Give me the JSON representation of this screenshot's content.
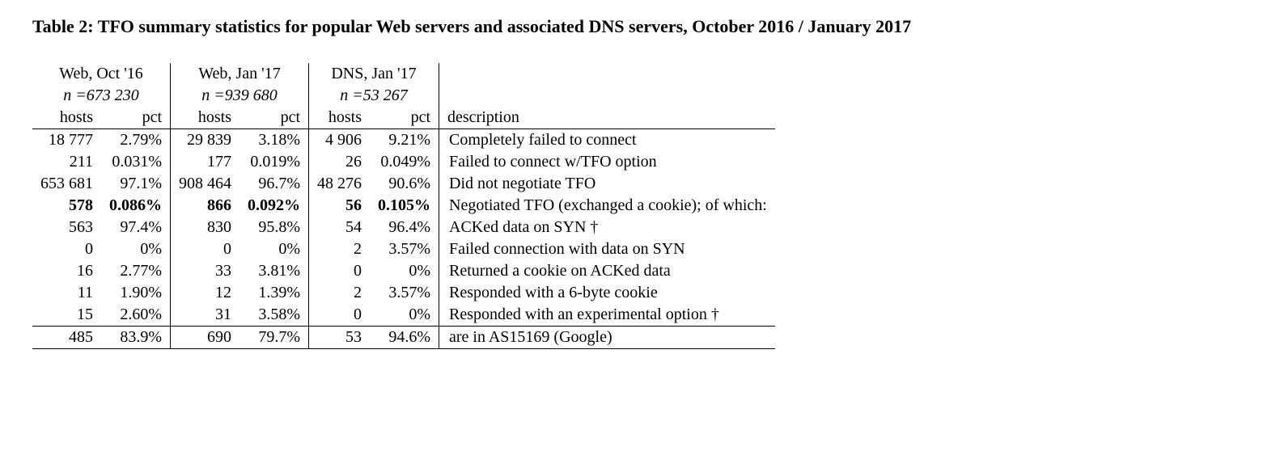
{
  "caption": "Table 2: TFO summary statistics for popular Web servers and associated DNS servers, October 2016 / January 2017",
  "groups": [
    {
      "label": "Web, Oct '16",
      "n": "n =673 230"
    },
    {
      "label": "Web, Jan '17",
      "n": "n =939 680"
    },
    {
      "label": "DNS, Jan '17",
      "n": "n =53 267"
    }
  ],
  "colLabels": {
    "hosts": "hosts",
    "pct": "pct",
    "desc": "description"
  },
  "rows": [
    {
      "bold": false,
      "desc": "Completely failed to connect",
      "cells": [
        {
          "hosts": "18 777",
          "pct": "2.79%"
        },
        {
          "hosts": "29 839",
          "pct": "3.18%"
        },
        {
          "hosts": "4 906",
          "pct": "9.21%"
        }
      ]
    },
    {
      "bold": false,
      "desc": "Failed to connect w/TFO option",
      "cells": [
        {
          "hosts": "211",
          "pct": "0.031%"
        },
        {
          "hosts": "177",
          "pct": "0.019%"
        },
        {
          "hosts": "26",
          "pct": "0.049%"
        }
      ]
    },
    {
      "bold": false,
      "desc": "Did not negotiate TFO",
      "cells": [
        {
          "hosts": "653 681",
          "pct": "97.1%"
        },
        {
          "hosts": "908 464",
          "pct": "96.7%"
        },
        {
          "hosts": "48 276",
          "pct": "90.6%"
        }
      ]
    },
    {
      "bold": true,
      "desc": "Negotiated TFO (exchanged a cookie); of which:",
      "cells": [
        {
          "hosts": "578",
          "pct": "0.086%"
        },
        {
          "hosts": "866",
          "pct": "0.092%"
        },
        {
          "hosts": "56",
          "pct": "0.105%"
        }
      ]
    },
    {
      "bold": false,
      "desc": "ACKed data on SYN †",
      "cells": [
        {
          "hosts": "563",
          "pct": "97.4%"
        },
        {
          "hosts": "830",
          "pct": "95.8%"
        },
        {
          "hosts": "54",
          "pct": "96.4%"
        }
      ]
    },
    {
      "bold": false,
      "desc": "Failed connection with data on SYN",
      "cells": [
        {
          "hosts": "0",
          "pct": "0%"
        },
        {
          "hosts": "0",
          "pct": "0%"
        },
        {
          "hosts": "2",
          "pct": "3.57%"
        }
      ]
    },
    {
      "bold": false,
      "desc": "Returned a cookie on ACKed data",
      "cells": [
        {
          "hosts": "16",
          "pct": "2.77%"
        },
        {
          "hosts": "33",
          "pct": "3.81%"
        },
        {
          "hosts": "0",
          "pct": "0%"
        }
      ]
    },
    {
      "bold": false,
      "desc": "Responded with a 6-byte cookie",
      "cells": [
        {
          "hosts": "11",
          "pct": "1.90%"
        },
        {
          "hosts": "12",
          "pct": "1.39%"
        },
        {
          "hosts": "2",
          "pct": "3.57%"
        }
      ]
    },
    {
      "bold": false,
      "desc": "Responded with an experimental option †",
      "cells": [
        {
          "hosts": "15",
          "pct": "2.60%"
        },
        {
          "hosts": "31",
          "pct": "3.58%"
        },
        {
          "hosts": "0",
          "pct": "0%"
        }
      ]
    },
    {
      "bold": false,
      "desc": "are in AS15169 (Google)",
      "cells": [
        {
          "hosts": "485",
          "pct": "83.9%"
        },
        {
          "hosts": "690",
          "pct": "79.7%"
        },
        {
          "hosts": "53",
          "pct": "94.6%"
        }
      ]
    }
  ],
  "chart_data": {
    "type": "table",
    "title": "TFO summary statistics for popular Web servers and associated DNS servers, October 2016 / January 2017",
    "groups": [
      {
        "name": "Web, Oct '16",
        "n": 673230
      },
      {
        "name": "Web, Jan '17",
        "n": 939680
      },
      {
        "name": "DNS, Jan '17",
        "n": 53267
      }
    ],
    "columns": [
      "hosts",
      "pct"
    ],
    "rows": [
      {
        "description": "Completely failed to connect",
        "values": [
          [
            18777,
            2.79
          ],
          [
            29839,
            3.18
          ],
          [
            4906,
            9.21
          ]
        ]
      },
      {
        "description": "Failed to connect w/TFO option",
        "values": [
          [
            211,
            0.031
          ],
          [
            177,
            0.019
          ],
          [
            26,
            0.049
          ]
        ]
      },
      {
        "description": "Did not negotiate TFO",
        "values": [
          [
            653681,
            97.1
          ],
          [
            908464,
            96.7
          ],
          [
            48276,
            90.6
          ]
        ]
      },
      {
        "description": "Negotiated TFO (exchanged a cookie); of which:",
        "bold": true,
        "values": [
          [
            578,
            0.086
          ],
          [
            866,
            0.092
          ],
          [
            56,
            0.105
          ]
        ]
      },
      {
        "description": "ACKed data on SYN †",
        "values": [
          [
            563,
            97.4
          ],
          [
            830,
            95.8
          ],
          [
            54,
            96.4
          ]
        ]
      },
      {
        "description": "Failed connection with data on SYN",
        "values": [
          [
            0,
            0
          ],
          [
            0,
            0
          ],
          [
            2,
            3.57
          ]
        ]
      },
      {
        "description": "Returned a cookie on ACKed data",
        "values": [
          [
            16,
            2.77
          ],
          [
            33,
            3.81
          ],
          [
            0,
            0
          ]
        ]
      },
      {
        "description": "Responded with a 6-byte cookie",
        "values": [
          [
            11,
            1.9
          ],
          [
            12,
            1.39
          ],
          [
            2,
            3.57
          ]
        ]
      },
      {
        "description": "Responded with an experimental option †",
        "values": [
          [
            15,
            2.6
          ],
          [
            31,
            3.58
          ],
          [
            0,
            0
          ]
        ]
      },
      {
        "description": "are in AS15169 (Google)",
        "values": [
          [
            485,
            83.9
          ],
          [
            690,
            79.7
          ],
          [
            53,
            94.6
          ]
        ]
      }
    ]
  }
}
